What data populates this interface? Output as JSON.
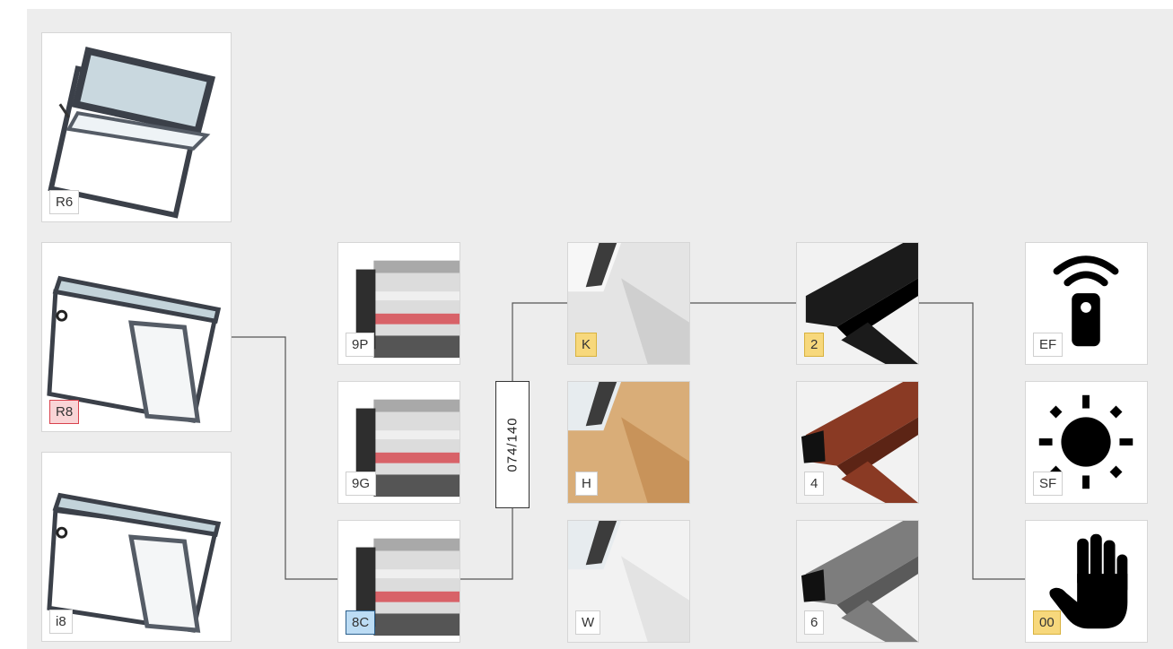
{
  "window_types": [
    {
      "id": "r6",
      "label": "R6",
      "style": "plain"
    },
    {
      "id": "r8",
      "label": "R8",
      "style": "pink"
    },
    {
      "id": "i8",
      "label": "i8",
      "style": "plain"
    }
  ],
  "glazing": [
    {
      "id": "9p",
      "label": "9P",
      "style": "plain"
    },
    {
      "id": "9g",
      "label": "9G",
      "style": "plain"
    },
    {
      "id": "8c",
      "label": "8C",
      "style": "blue"
    }
  ],
  "size": {
    "label": "074/140"
  },
  "frame_finish": [
    {
      "id": "k",
      "label": "K",
      "style": "yellow",
      "color": "#e4e4e4"
    },
    {
      "id": "h",
      "label": "H",
      "style": "plain",
      "color": "#d9ad78"
    },
    {
      "id": "w",
      "label": "W",
      "style": "plain",
      "color": "#f2f2f2"
    }
  ],
  "flashing_color": [
    {
      "id": "2",
      "label": "2",
      "style": "yellow",
      "color": "#1b1b1b"
    },
    {
      "id": "4",
      "label": "4",
      "style": "plain",
      "color": "#8a3a24"
    },
    {
      "id": "6",
      "label": "6",
      "style": "plain",
      "color": "#7d7d7d"
    }
  ],
  "control": [
    {
      "id": "ef",
      "label": "EF",
      "style": "plain",
      "icon": "remote-control-icon"
    },
    {
      "id": "sf",
      "label": "SF",
      "style": "plain",
      "icon": "sun-icon"
    },
    {
      "id": "00",
      "label": "00",
      "style": "yellow",
      "icon": "hand-icon"
    }
  ],
  "colors": {
    "background": "#ededed",
    "connector": "#555555",
    "highlight_yellow": "#f7d87c",
    "highlight_pink": "#f9d4d6",
    "highlight_blue": "#bcdcf4"
  }
}
